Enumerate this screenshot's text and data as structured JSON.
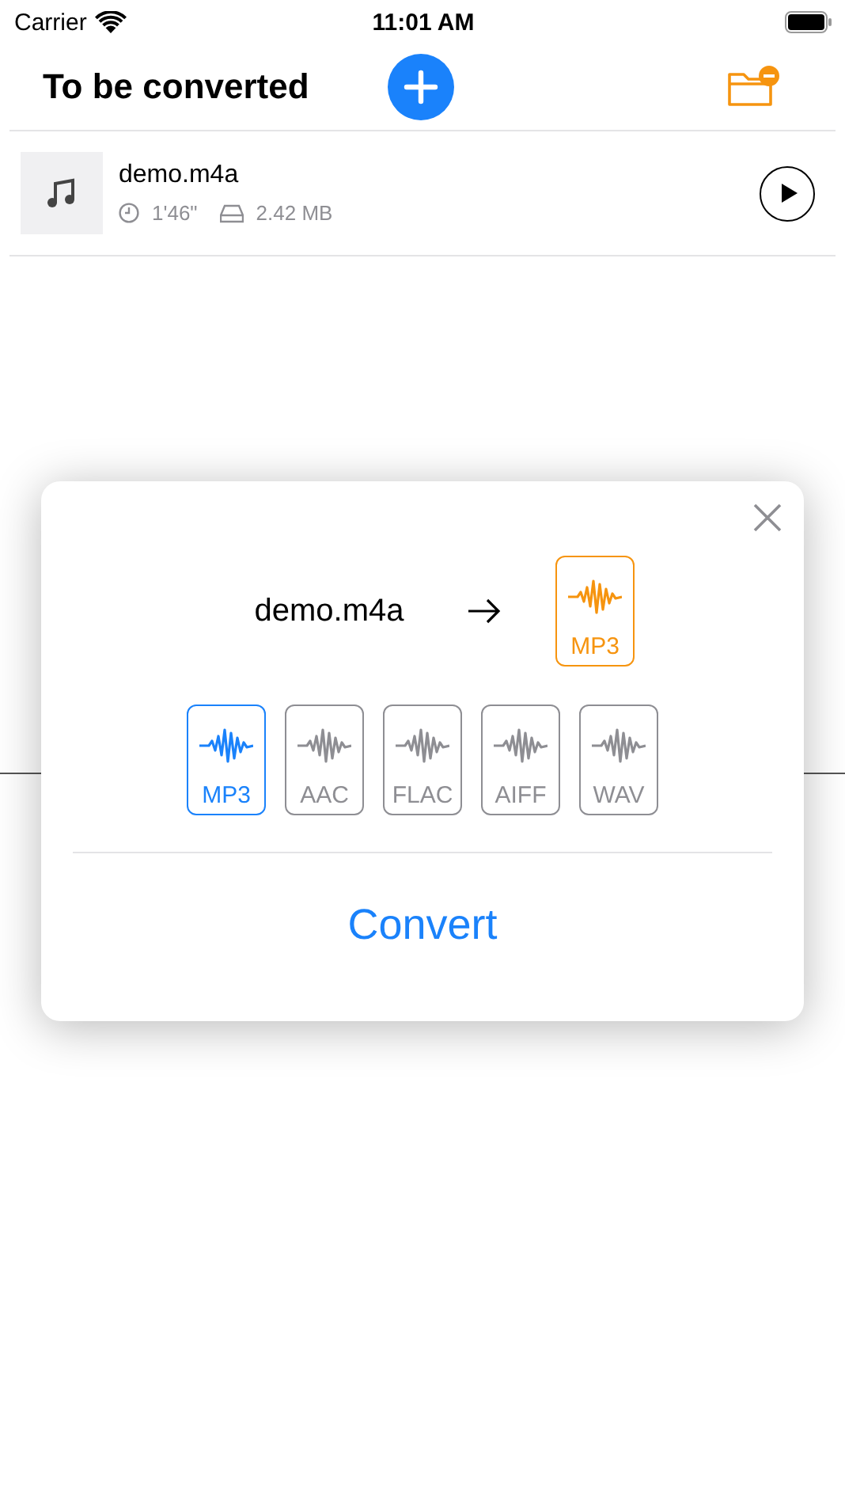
{
  "status_bar": {
    "carrier": "Carrier",
    "time": "11:01 AM"
  },
  "header": {
    "title": "To be converted"
  },
  "files": [
    {
      "name": "demo.m4a",
      "duration": "1'46\"",
      "size": "2.42 MB"
    }
  ],
  "dialog": {
    "source": "demo.m4a",
    "target": "MP3",
    "formats": [
      {
        "label": "MP3",
        "selected": true
      },
      {
        "label": "AAC",
        "selected": false
      },
      {
        "label": "FLAC",
        "selected": false
      },
      {
        "label": "AIFF",
        "selected": false
      },
      {
        "label": "WAV",
        "selected": false
      }
    ],
    "action": "Convert"
  }
}
